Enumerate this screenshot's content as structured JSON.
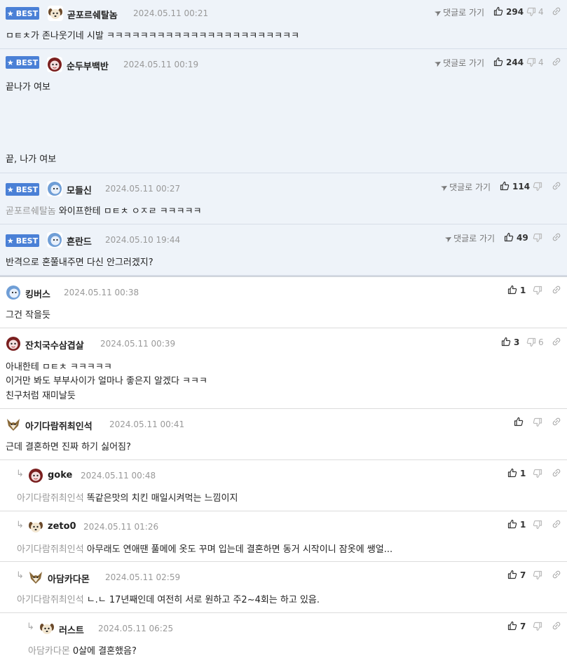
{
  "comments": [
    {
      "best": "BEST",
      "nick": "곧포르쉐탈놈",
      "date": "2024.05.11 00:21",
      "lines": [
        "ㅁㅌㅊ가 존나웃기네 시발 ㅋㅋㅋㅋㅋㅋㅋㅋㅋㅋㅋㅋㅋㅋㅋㅋㅋㅋㅋㅋㅋㅋㅋ"
      ],
      "goto": "댓글로 가기",
      "likes": "294",
      "dislikes": "4"
    },
    {
      "best": "BEST",
      "nick": "순두부백반",
      "date": "2024.05.11 00:19",
      "lines": [
        "끝나가 여보",
        "끝, 나가 여보"
      ],
      "goto": "댓글로 가기",
      "likes": "244",
      "dislikes": "4"
    },
    {
      "best": "BEST",
      "nick": "모들신",
      "date": "2024.05.11 00:27",
      "mention": "곧포르쉐탈놈",
      "lines": [
        "와이프한테 ㅁㅌㅊ ㅇㅈㄹ ㅋㅋㅋㅋㅋ"
      ],
      "goto": "댓글로 가기",
      "likes": "114",
      "dislikes": ""
    },
    {
      "best": "BEST",
      "nick": "흔란드",
      "date": "2024.05.10 19:44",
      "lines": [
        "반격으로 혼쭐내주면 다신 안그러겠지?"
      ],
      "goto": "댓글로 가기",
      "likes": "49",
      "dislikes": ""
    },
    {
      "nick": "킹버스",
      "date": "2024.05.11 00:38",
      "lines": [
        "그건 작을듯"
      ],
      "likes": "1",
      "dislikes": ""
    },
    {
      "nick": "잔치국수삼겹살",
      "date": "2024.05.11 00:39",
      "lines": [
        "아내한테 ㅁㅌㅊ ㅋㅋㅋㅋㅋ",
        "이거만 봐도 부부사이가 얼마나 좋은지 알겠다 ㅋㅋㅋ",
        "친구처럼 재미날듯"
      ],
      "likes": "3",
      "dislikes": "6"
    },
    {
      "nick": "아기다람쥐최인석",
      "date": "2024.05.11 00:41",
      "lines": [
        "근데 결혼하면 진짜 하기 싫어짐?"
      ],
      "likes": "",
      "dislikes": ""
    },
    {
      "nick": "goke",
      "date": "2024.05.11 00:48",
      "mention": "아기다람쥐최인석",
      "lines": [
        "똑같은맛의 치킨 매일시켜먹는 느낌이지"
      ],
      "likes": "1",
      "dislikes": ""
    },
    {
      "nick": "zeto0",
      "date": "2024.05.11 01:26",
      "mention": "아기다람쥐최인석",
      "lines": [
        "아무래도 연애땐 풀메에 옷도 꾸며 입는데 결혼하면 동거 시작이니 잠옷에 쌩얼..."
      ],
      "likes": "1",
      "dislikes": ""
    },
    {
      "nick": "아담카다몬",
      "date": "2024.05.11 02:59",
      "mention": "아기다람쥐최인석",
      "lines": [
        "ㄴ.ㄴ 17년째인데 여전히 서로 원하고 주2~4회는 하고 있음."
      ],
      "likes": "7",
      "dislikes": ""
    },
    {
      "nick": "러스트",
      "date": "2024.05.11 06:25",
      "mention": "아담카다몬",
      "lines": [
        "0살에 결혼했음?"
      ],
      "likes": "7",
      "dislikes": ""
    }
  ],
  "icons": {
    "like": "thumbs-up-icon",
    "dislike": "thumbs-down-icon",
    "link": "link-icon",
    "goto": "send-arrow-icon",
    "reply": "reply-arrow-icon"
  }
}
